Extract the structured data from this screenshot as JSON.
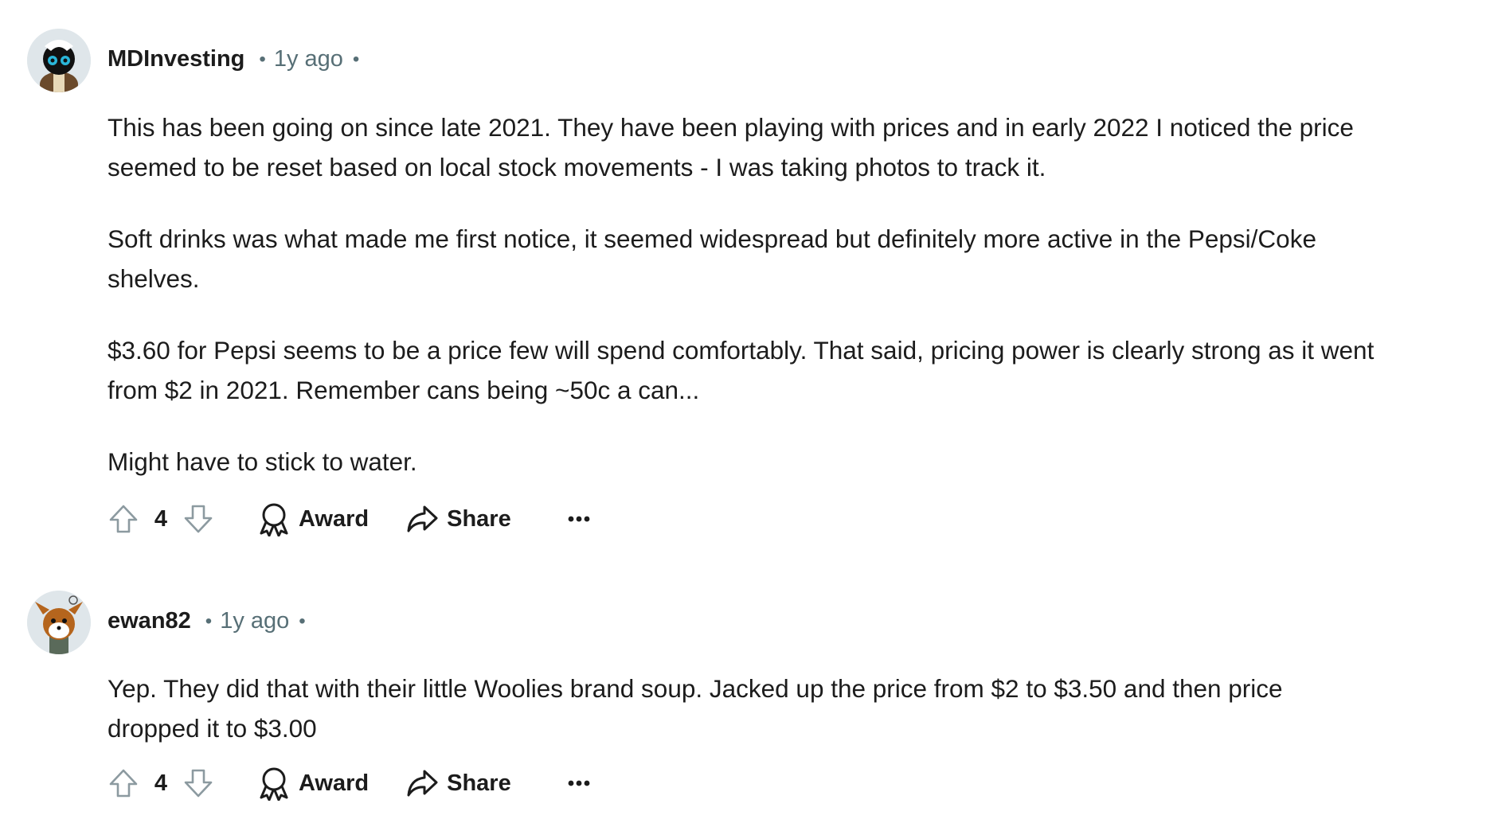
{
  "comments": [
    {
      "username": "MDInvesting",
      "separator": "•",
      "time": "1y ago",
      "paragraphs": [
        "This has been going on since late 2021. They have been playing with prices and in early 2022 I noticed the price",
        "seemed to be reset based on local stock movements - I was taking photos to track it.",
        "Soft drinks was what made me first notice, it seemed widespread but definitely more active in the Pepsi/Coke",
        "shelves.",
        "$3.60 for Pepsi seems to be a price few will spend comfortably. That said, pricing power is clearly strong as it went",
        "from $2 in 2021. Remember cans being ~50c a can...",
        "Might have to stick to water."
      ],
      "score": "4",
      "award_label": "Award",
      "share_label": "Share",
      "avatar_icon": "skunk-avatar-icon"
    },
    {
      "username": "ewan82",
      "separator": "•",
      "time": "1y ago",
      "paragraphs": [
        "Yep. They did that with their little Woolies brand soup. Jacked up the price from $2 to $3.50 and then price",
        "dropped it to $3.00"
      ],
      "score": "4",
      "award_label": "Award",
      "share_label": "Share",
      "avatar_icon": "fox-avatar-icon"
    }
  ],
  "colors": {
    "text": "#1c1c1c",
    "meta": "#576f76",
    "icon": "#1c1c1c",
    "vote_icon": "#8c9aa0"
  }
}
